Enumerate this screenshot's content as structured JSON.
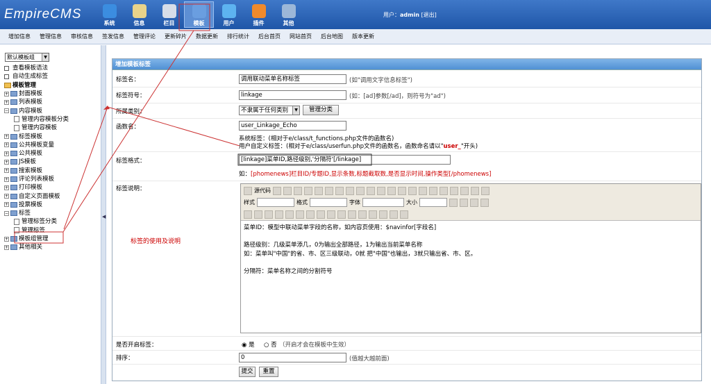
{
  "app": {
    "logo": "EmpireCMS",
    "user_label": "用户：",
    "username": "admin",
    "logout": "[退出]"
  },
  "mainnav": [
    {
      "label": "系统",
      "icon": "globe-icon",
      "color": "#3b8de0"
    },
    {
      "label": "信息",
      "icon": "edit-icon",
      "color": "#e8d38a"
    },
    {
      "label": "栏目",
      "icon": "folder-icon",
      "color": "#d7dde8"
    },
    {
      "label": "模板",
      "icon": "template-icon",
      "color": "#6a9ee0",
      "active": true
    },
    {
      "label": "用户",
      "icon": "user-icon",
      "color": "#5db3f0"
    },
    {
      "label": "插件",
      "icon": "tools-icon",
      "color": "#f08a2c"
    },
    {
      "label": "其他",
      "icon": "gear-icon",
      "color": "#9cb7d8"
    }
  ],
  "subnav": [
    "增加信息",
    "管理信息",
    "审核信息",
    "签发信息",
    "管理评论",
    "更新碎片",
    "数据更新",
    "排行统计",
    "后台首页",
    "网站首页",
    "后台地图",
    "版本更新"
  ],
  "sidebar": {
    "group_select": "默认模板组",
    "links": [
      "查看模板语法",
      "自动生成标签"
    ],
    "tree": [
      {
        "label": "模板管理",
        "level": 0,
        "type": "root",
        "bold": true
      },
      {
        "label": "封面模板",
        "level": 0,
        "type": "folder"
      },
      {
        "label": "列表模板",
        "level": 0,
        "type": "folder"
      },
      {
        "label": "内容模板",
        "level": 0,
        "type": "folder",
        "open": true
      },
      {
        "label": "管理内容模板分类",
        "level": 1,
        "type": "doc"
      },
      {
        "label": "管理内容模板",
        "level": 1,
        "type": "doc"
      },
      {
        "label": "标签模板",
        "level": 0,
        "type": "folder"
      },
      {
        "label": "公共模板变量",
        "level": 0,
        "type": "folder"
      },
      {
        "label": "公共模板",
        "level": 0,
        "type": "folder"
      },
      {
        "label": "JS模板",
        "level": 0,
        "type": "folder"
      },
      {
        "label": "搜索模板",
        "level": 0,
        "type": "folder"
      },
      {
        "label": "评论列表模板",
        "level": 0,
        "type": "folder"
      },
      {
        "label": "打印模板",
        "level": 0,
        "type": "folder"
      },
      {
        "label": "自定义页面模板",
        "level": 0,
        "type": "folder"
      },
      {
        "label": "投票模板",
        "level": 0,
        "type": "folder"
      },
      {
        "label": "标签",
        "level": 0,
        "type": "folder",
        "open": true
      },
      {
        "label": "管理标签分类",
        "level": 1,
        "type": "doc"
      },
      {
        "label": "管理标签",
        "level": 1,
        "type": "doc",
        "highlight": true
      },
      {
        "label": "模板组管理",
        "level": 0,
        "type": "folder"
      },
      {
        "label": "其他相关",
        "level": 0,
        "type": "folder"
      }
    ]
  },
  "form": {
    "header": "增加模板标签",
    "tag_name_label": "标签名：",
    "tag_name_value": "调用联动菜单名称标签",
    "tag_name_hint": "(如\"调用文字信息标签\")",
    "tag_sign_label": "标签符号：",
    "tag_sign_value": "linkage",
    "tag_sign_hint": "(如：[ad]参数[/ad]，则符号为\"ad\")",
    "category_label": "所属类别：",
    "category_value": "不隶属于任何类别",
    "category_button": "管理分类",
    "func_label": "函数名：",
    "func_value": "user_Linkage_Echo",
    "func_note1": "系统标签：(相对于e/class/t_functions.php文件的函数名)",
    "func_note2_prefix": "用户自定义标签：(相对于e/class/userfun.php文件的函数名，函数命名请以\"",
    "func_note2_user": "user_",
    "func_note2_suffix": "\"开头)",
    "format_label": "标签格式：",
    "format_value": "[linkage]菜单ID,路径级别,'分隔符'[/linkage]",
    "format_example_prefix": "如：",
    "format_example": "[phomenews]栏目ID/专题ID,显示条数,标题截取数,是否显示时间,操作类型[/phomenews]",
    "desc_label": "标签说明：",
    "desc_annotation": "标签的使用及说明",
    "toolbar": {
      "source": "源代码",
      "style": "样式",
      "format": "格式",
      "font": "字体",
      "size": "大小"
    },
    "desc_lines": [
      "菜单ID：模型中联动菜单字段的名称，如内容页使用：$navinfor[字段名]",
      "",
      "路径级别：几级菜单添几，0为输出全部路径，1为输出当前菜单名称",
      "如：菜单叫\"中国\"的省、市、区三级联动，0就 把\"中国\"也输出，3就只输出省、市、区。",
      "",
      "分隔符：菜单名称之间的分割符号"
    ],
    "open_label": "是否开启标签：",
    "open_yes": "是",
    "open_no": "否",
    "open_hint": "（开启才会在模板中生效）",
    "sort_label": "排序：",
    "sort_value": "0",
    "sort_hint": "(值越大越前面)",
    "submit": "提交",
    "reset": "重置"
  },
  "colors": {
    "accent": "#4f90d4",
    "annotation": "#cc0000"
  }
}
